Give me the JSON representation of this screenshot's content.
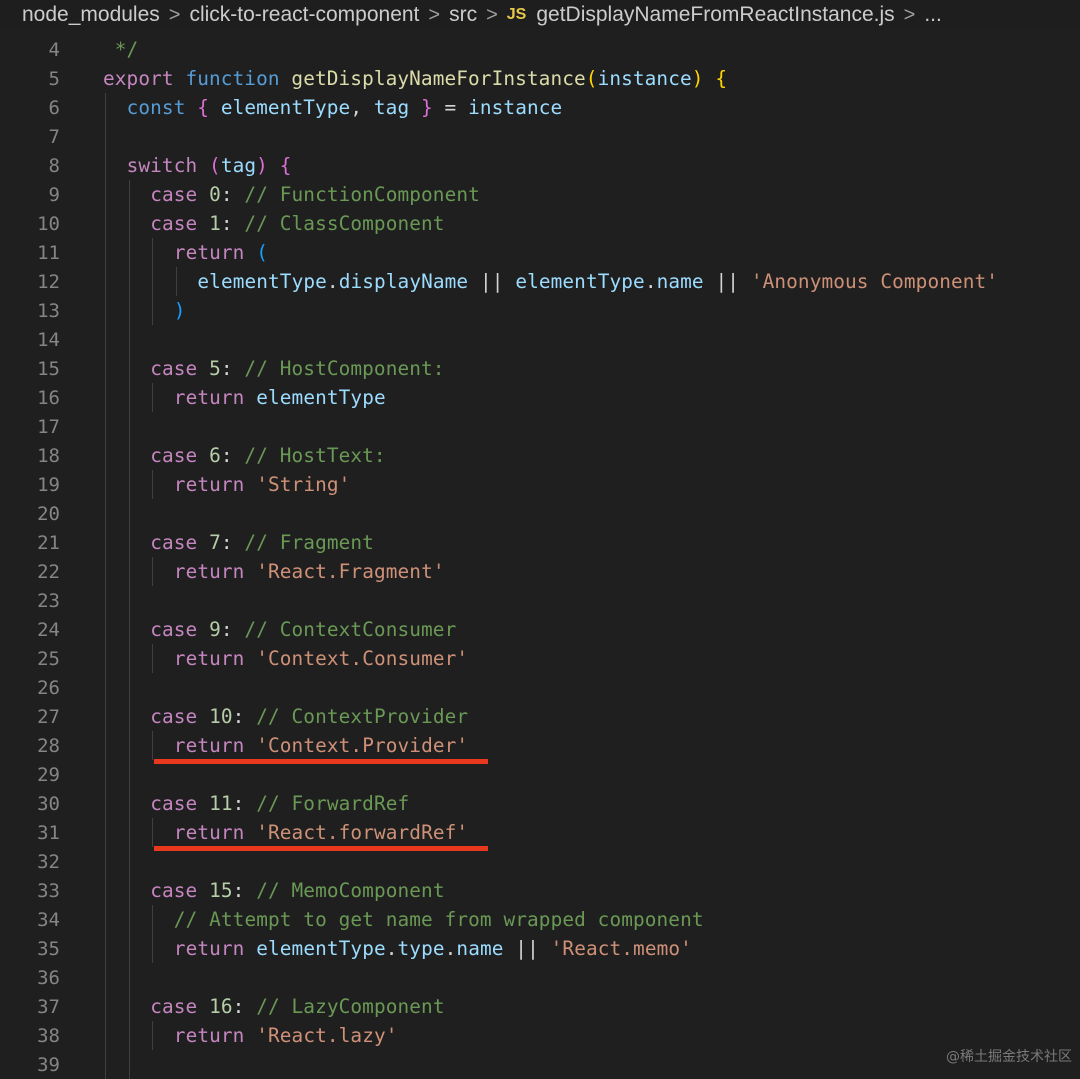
{
  "breadcrumb": {
    "items": [
      "node_modules",
      "click-to-react-component",
      "src"
    ],
    "file_badge": "JS",
    "file_name": "getDisplayNameFromReactInstance.js",
    "trailing": "..."
  },
  "editor": {
    "language": "javascript",
    "lines": [
      {
        "n": "4",
        "indent": 0,
        "tokens": [
          {
            "t": " */",
            "c": "cmt"
          }
        ]
      },
      {
        "n": "5",
        "indent": 0,
        "tokens": [
          {
            "t": "export",
            "c": "kw"
          },
          {
            "t": " ",
            "c": "op"
          },
          {
            "t": "function",
            "c": "decl"
          },
          {
            "t": " ",
            "c": "op"
          },
          {
            "t": "getDisplayNameForInstance",
            "c": "fn"
          },
          {
            "t": "(",
            "c": "p1"
          },
          {
            "t": "instance",
            "c": "var"
          },
          {
            "t": ")",
            "c": "p1"
          },
          {
            "t": " ",
            "c": "op"
          },
          {
            "t": "{",
            "c": "p1"
          }
        ]
      },
      {
        "n": "6",
        "indent": 1,
        "tokens": [
          {
            "t": "const",
            "c": "decl"
          },
          {
            "t": " ",
            "c": "op"
          },
          {
            "t": "{",
            "c": "p2"
          },
          {
            "t": " ",
            "c": "op"
          },
          {
            "t": "elementType",
            "c": "var"
          },
          {
            "t": ", ",
            "c": "op"
          },
          {
            "t": "tag",
            "c": "var"
          },
          {
            "t": " ",
            "c": "op"
          },
          {
            "t": "}",
            "c": "p2"
          },
          {
            "t": " = ",
            "c": "op"
          },
          {
            "t": "instance",
            "c": "var"
          }
        ]
      },
      {
        "n": "7",
        "indent": 1,
        "tokens": []
      },
      {
        "n": "8",
        "indent": 1,
        "tokens": [
          {
            "t": "switch",
            "c": "kw"
          },
          {
            "t": " ",
            "c": "op"
          },
          {
            "t": "(",
            "c": "p2"
          },
          {
            "t": "tag",
            "c": "var"
          },
          {
            "t": ")",
            "c": "p2"
          },
          {
            "t": " ",
            "c": "op"
          },
          {
            "t": "{",
            "c": "p2"
          }
        ]
      },
      {
        "n": "9",
        "indent": 2,
        "tokens": [
          {
            "t": "case",
            "c": "kw"
          },
          {
            "t": " ",
            "c": "op"
          },
          {
            "t": "0",
            "c": "num"
          },
          {
            "t": ": ",
            "c": "op"
          },
          {
            "t": "// FunctionComponent",
            "c": "cmt"
          }
        ]
      },
      {
        "n": "10",
        "indent": 2,
        "tokens": [
          {
            "t": "case",
            "c": "kw"
          },
          {
            "t": " ",
            "c": "op"
          },
          {
            "t": "1",
            "c": "num"
          },
          {
            "t": ": ",
            "c": "op"
          },
          {
            "t": "// ClassComponent",
            "c": "cmt"
          }
        ]
      },
      {
        "n": "11",
        "indent": 3,
        "tokens": [
          {
            "t": "return",
            "c": "kw"
          },
          {
            "t": " ",
            "c": "op"
          },
          {
            "t": "(",
            "c": "p3"
          }
        ]
      },
      {
        "n": "12",
        "indent": 4,
        "tokens": [
          {
            "t": "elementType",
            "c": "var"
          },
          {
            "t": ".",
            "c": "op"
          },
          {
            "t": "displayName",
            "c": "prop"
          },
          {
            "t": " || ",
            "c": "op"
          },
          {
            "t": "elementType",
            "c": "var"
          },
          {
            "t": ".",
            "c": "op"
          },
          {
            "t": "name",
            "c": "prop"
          },
          {
            "t": " || ",
            "c": "op"
          },
          {
            "t": "'Anonymous Component'",
            "c": "str"
          }
        ]
      },
      {
        "n": "13",
        "indent": 3,
        "tokens": [
          {
            "t": ")",
            "c": "p3"
          }
        ]
      },
      {
        "n": "14",
        "indent": 2,
        "tokens": []
      },
      {
        "n": "15",
        "indent": 2,
        "tokens": [
          {
            "t": "case",
            "c": "kw"
          },
          {
            "t": " ",
            "c": "op"
          },
          {
            "t": "5",
            "c": "num"
          },
          {
            "t": ": ",
            "c": "op"
          },
          {
            "t": "// HostComponent:",
            "c": "cmt"
          }
        ]
      },
      {
        "n": "16",
        "indent": 3,
        "tokens": [
          {
            "t": "return",
            "c": "kw"
          },
          {
            "t": " ",
            "c": "op"
          },
          {
            "t": "elementType",
            "c": "var"
          }
        ]
      },
      {
        "n": "17",
        "indent": 2,
        "tokens": []
      },
      {
        "n": "18",
        "indent": 2,
        "tokens": [
          {
            "t": "case",
            "c": "kw"
          },
          {
            "t": " ",
            "c": "op"
          },
          {
            "t": "6",
            "c": "num"
          },
          {
            "t": ": ",
            "c": "op"
          },
          {
            "t": "// HostText:",
            "c": "cmt"
          }
        ]
      },
      {
        "n": "19",
        "indent": 3,
        "tokens": [
          {
            "t": "return",
            "c": "kw"
          },
          {
            "t": " ",
            "c": "op"
          },
          {
            "t": "'String'",
            "c": "str"
          }
        ]
      },
      {
        "n": "20",
        "indent": 2,
        "tokens": []
      },
      {
        "n": "21",
        "indent": 2,
        "tokens": [
          {
            "t": "case",
            "c": "kw"
          },
          {
            "t": " ",
            "c": "op"
          },
          {
            "t": "7",
            "c": "num"
          },
          {
            "t": ": ",
            "c": "op"
          },
          {
            "t": "// Fragment",
            "c": "cmt"
          }
        ]
      },
      {
        "n": "22",
        "indent": 3,
        "tokens": [
          {
            "t": "return",
            "c": "kw"
          },
          {
            "t": " ",
            "c": "op"
          },
          {
            "t": "'React.Fragment'",
            "c": "str"
          }
        ]
      },
      {
        "n": "23",
        "indent": 2,
        "tokens": []
      },
      {
        "n": "24",
        "indent": 2,
        "tokens": [
          {
            "t": "case",
            "c": "kw"
          },
          {
            "t": " ",
            "c": "op"
          },
          {
            "t": "9",
            "c": "num"
          },
          {
            "t": ": ",
            "c": "op"
          },
          {
            "t": "// ContextConsumer",
            "c": "cmt"
          }
        ]
      },
      {
        "n": "25",
        "indent": 3,
        "tokens": [
          {
            "t": "return",
            "c": "kw"
          },
          {
            "t": " ",
            "c": "op"
          },
          {
            "t": "'Context.Consumer'",
            "c": "str"
          }
        ]
      },
      {
        "n": "26",
        "indent": 2,
        "tokens": []
      },
      {
        "n": "27",
        "indent": 2,
        "tokens": [
          {
            "t": "case",
            "c": "kw"
          },
          {
            "t": " ",
            "c": "op"
          },
          {
            "t": "10",
            "c": "num"
          },
          {
            "t": ": ",
            "c": "op"
          },
          {
            "t": "// ContextProvider",
            "c": "cmt"
          }
        ]
      },
      {
        "n": "28",
        "indent": 3,
        "tokens": [
          {
            "t": "return",
            "c": "kw"
          },
          {
            "t": " ",
            "c": "op"
          },
          {
            "t": "'Context.Provider'",
            "c": "str"
          }
        ],
        "underlined": true
      },
      {
        "n": "29",
        "indent": 2,
        "tokens": []
      },
      {
        "n": "30",
        "indent": 2,
        "tokens": [
          {
            "t": "case",
            "c": "kw"
          },
          {
            "t": " ",
            "c": "op"
          },
          {
            "t": "11",
            "c": "num"
          },
          {
            "t": ": ",
            "c": "op"
          },
          {
            "t": "// ForwardRef",
            "c": "cmt"
          }
        ]
      },
      {
        "n": "31",
        "indent": 3,
        "tokens": [
          {
            "t": "return",
            "c": "kw"
          },
          {
            "t": " ",
            "c": "op"
          },
          {
            "t": "'React.forwardRef'",
            "c": "str"
          }
        ],
        "underlined": true
      },
      {
        "n": "32",
        "indent": 2,
        "tokens": []
      },
      {
        "n": "33",
        "indent": 2,
        "tokens": [
          {
            "t": "case",
            "c": "kw"
          },
          {
            "t": " ",
            "c": "op"
          },
          {
            "t": "15",
            "c": "num"
          },
          {
            "t": ": ",
            "c": "op"
          },
          {
            "t": "// MemoComponent",
            "c": "cmt"
          }
        ]
      },
      {
        "n": "34",
        "indent": 3,
        "tokens": [
          {
            "t": "// Attempt to get name from wrapped component",
            "c": "cmt"
          }
        ]
      },
      {
        "n": "35",
        "indent": 3,
        "tokens": [
          {
            "t": "return",
            "c": "kw"
          },
          {
            "t": " ",
            "c": "op"
          },
          {
            "t": "elementType",
            "c": "var"
          },
          {
            "t": ".",
            "c": "op"
          },
          {
            "t": "type",
            "c": "prop"
          },
          {
            "t": ".",
            "c": "op"
          },
          {
            "t": "name",
            "c": "prop"
          },
          {
            "t": " || ",
            "c": "op"
          },
          {
            "t": "'React.memo'",
            "c": "str"
          }
        ]
      },
      {
        "n": "36",
        "indent": 2,
        "tokens": []
      },
      {
        "n": "37",
        "indent": 2,
        "tokens": [
          {
            "t": "case",
            "c": "kw"
          },
          {
            "t": " ",
            "c": "op"
          },
          {
            "t": "16",
            "c": "num"
          },
          {
            "t": ": ",
            "c": "op"
          },
          {
            "t": "// LazyComponent",
            "c": "cmt"
          }
        ]
      },
      {
        "n": "38",
        "indent": 3,
        "tokens": [
          {
            "t": "return",
            "c": "kw"
          },
          {
            "t": " ",
            "c": "op"
          },
          {
            "t": "'React.lazy'",
            "c": "str"
          }
        ]
      },
      {
        "n": "39",
        "indent": 2,
        "tokens": []
      }
    ]
  },
  "highlight_color": "#e8391e",
  "watermark": "@稀土掘金技术社区"
}
